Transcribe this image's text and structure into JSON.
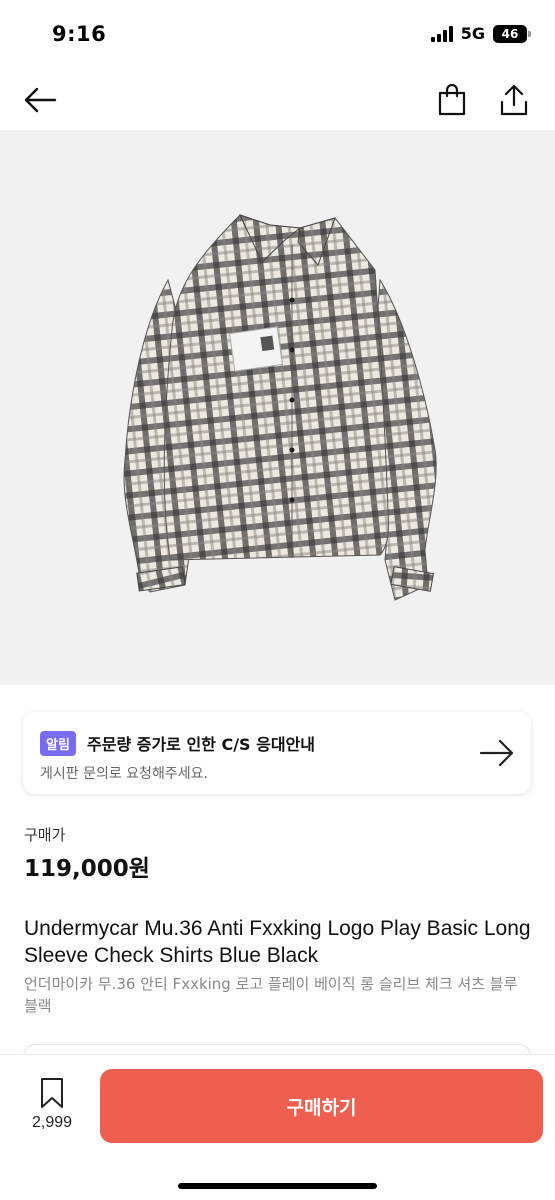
{
  "status_bar": {
    "time": "9:16",
    "network": "5G",
    "battery": "46"
  },
  "nav": {
    "back_icon": "arrow-left-icon",
    "bag_icon": "shopping-bag-icon",
    "share_icon": "share-icon"
  },
  "product_image": {
    "alt": "plaid long sleeve check shirt",
    "colors": {
      "background": "#f1f1f1",
      "plaid_dark": "#3a3a3a",
      "plaid_light": "#ece8e2"
    }
  },
  "notice": {
    "badge": "알림",
    "title": "주문량 증가로 인한 C/S 응대안내",
    "subtitle": "게시판 문의로 요청해주세요.",
    "badge_color": "#7a6cf0"
  },
  "price": {
    "label": "구매가",
    "value": "119,000원"
  },
  "product": {
    "title_en": "Undermycar Mu.36 Anti Fxxking Logo Play Basic Long Sleeve Check Shirts Blue Black",
    "title_ko": "언더마이카 무.36 안티 Fxxking 로고 플레이 베이직 롱 슬리브 체크 셔츠 블루 블랙"
  },
  "bottom_bar": {
    "wish_count": "2,999",
    "buy_label": "구매하기",
    "buy_color": "#ef5f4f"
  }
}
